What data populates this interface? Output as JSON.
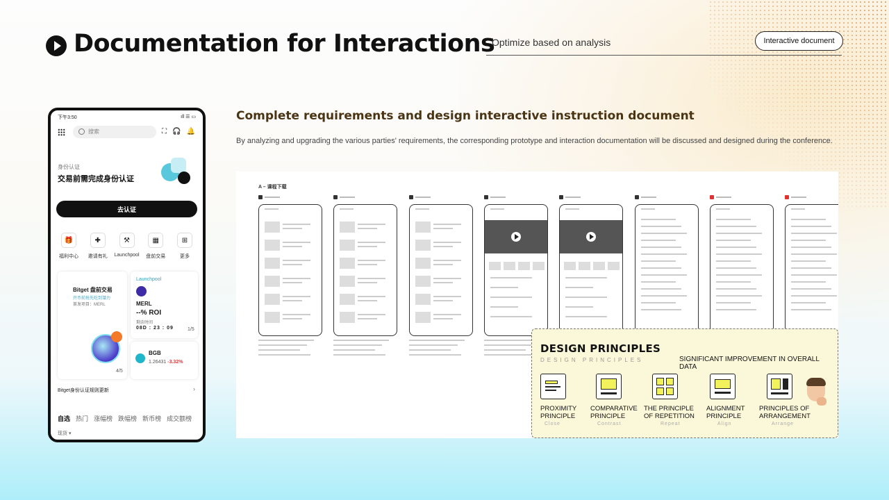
{
  "header": {
    "title": "Documentation for Interactions",
    "subtitle": "Optimize based on analysis",
    "button_label": "Interactive document"
  },
  "phone": {
    "status_time": "下午3:50",
    "status_right": "ıll ☰ ▭",
    "search_placeholder": "搜索",
    "id_label": "身份认证",
    "id_title": "交易前需完成身份认证",
    "verify_button": "去认证",
    "shortcuts": [
      {
        "label": "福利中心",
        "icon": "gift-icon"
      },
      {
        "label": "邀请有礼",
        "icon": "invite-icon"
      },
      {
        "label": "Launchpool",
        "icon": "pickaxe-icon"
      },
      {
        "label": "盘前交易",
        "icon": "calendar-icon"
      },
      {
        "label": "更多",
        "icon": "more-icon"
      }
    ],
    "card_left": {
      "title": "Bitget 盘前交易",
      "subtitle": "开币前抢先吃到潜力",
      "project": "首发项目：MERL",
      "page": "4/5"
    },
    "card_right": {
      "tag": "Launchpool",
      "name": "MERL",
      "roi": "--% ROI",
      "remaining_label": "剩余时间",
      "countdown": "08D : 23 : 09",
      "page": "1/5"
    },
    "card_bgb": {
      "name": "BGB",
      "price": "1.26431",
      "change": "-3.32%"
    },
    "notice": "Bitget身份认证规则更新",
    "tabs": [
      "自选",
      "热门",
      "涨幅榜",
      "跌幅榜",
      "新币榜",
      "成交额榜"
    ],
    "spot_label": "现货 ▾"
  },
  "content": {
    "section_title": "Complete requirements and design interactive instruction document",
    "description": "By analyzing and upgrading the various parties' requirements, the corresponding prototype and interaction documentation will be discussed and designed during the conference."
  },
  "prototype": {
    "label": "A – 课程下载",
    "screens": [
      {
        "type": "list",
        "head_red": false
      },
      {
        "type": "list",
        "head_red": false
      },
      {
        "type": "list",
        "head_red": false
      },
      {
        "type": "video",
        "head_red": false
      },
      {
        "type": "video",
        "head_red": false
      },
      {
        "type": "text",
        "head_red": false
      },
      {
        "type": "text",
        "head_red": true
      },
      {
        "type": "text",
        "head_red": true
      }
    ]
  },
  "design_principles": {
    "title": "DESIGN PRINCIPLES",
    "subtitle": "DESIGN PRINCIPLES",
    "note": "SIGNIFICANT IMPROVEMENT IN OVERALL DATA",
    "items": [
      {
        "name_1": "PROXIMITY",
        "name_2": "PRINCIPLE",
        "en": "Close",
        "icon": "proximity-icon"
      },
      {
        "name_1": "COMPARATIVE",
        "name_2": "PRINCIPLE",
        "en": "Contrast",
        "icon": "contrast-icon"
      },
      {
        "name_1": "THE PRINCIPLE",
        "name_2": "OF REPETITION",
        "en": "Repeat",
        "icon": "repeat-icon"
      },
      {
        "name_1": "ALIGNMENT",
        "name_2": "PRINCIPLE",
        "en": "Align",
        "icon": "align-icon"
      },
      {
        "name_1": "PRINCIPLES OF",
        "name_2": "ARRANGEMENT",
        "en": "Arrange",
        "icon": "arrange-icon"
      }
    ]
  },
  "colors": {
    "accent_brown": "#4a3413",
    "principle_yellow": "#f2f25c",
    "principle_bg": "#fbf7d9"
  }
}
